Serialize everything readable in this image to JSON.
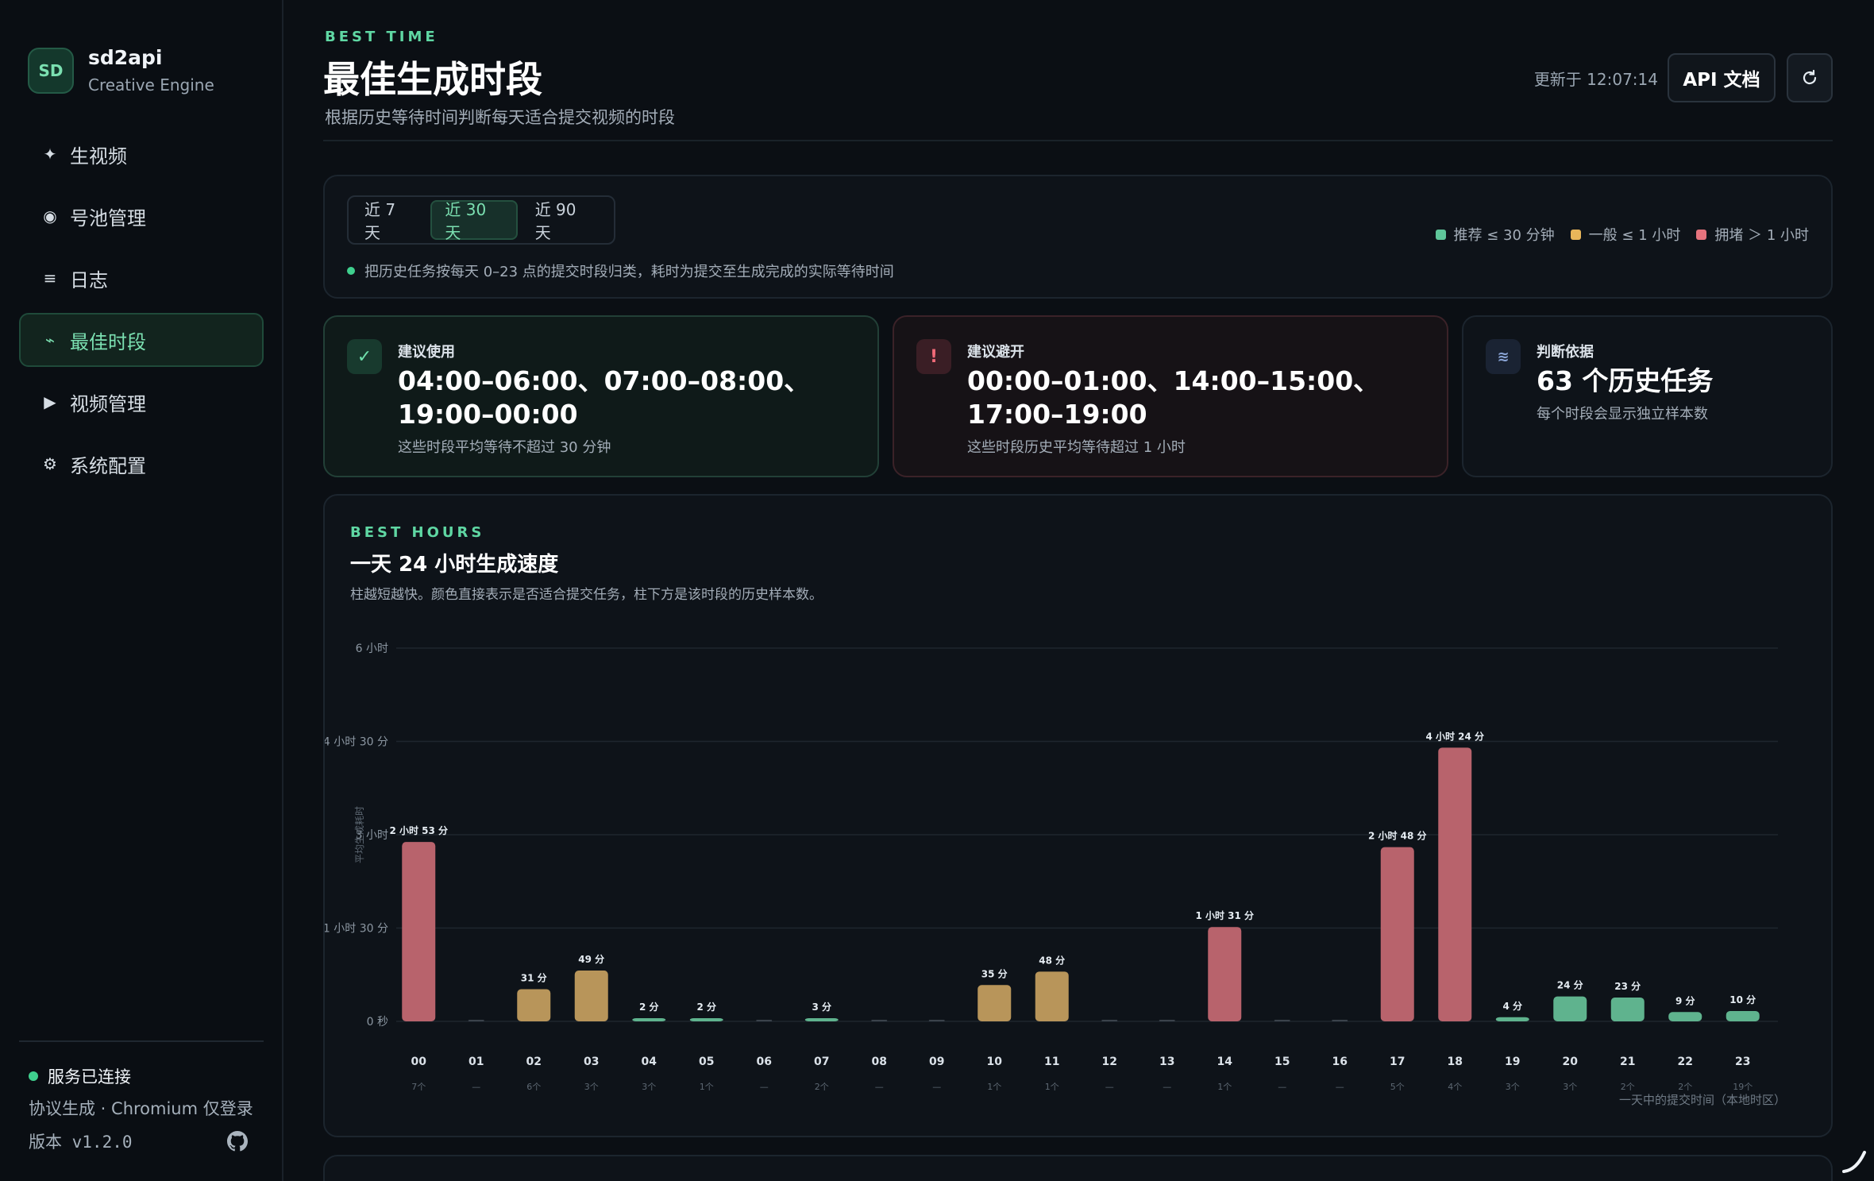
{
  "sidebar": {
    "logo": "SD",
    "name": "sd2api",
    "subtitle": "Creative Engine",
    "items": [
      {
        "label": "生视频",
        "icon": "sparkle-icon",
        "glyph": "✦"
      },
      {
        "label": "号池管理",
        "icon": "radio-icon",
        "glyph": "◉"
      },
      {
        "label": "日志",
        "icon": "list-icon",
        "glyph": "≡"
      },
      {
        "label": "最佳时段",
        "icon": "pulse-icon",
        "glyph": "⌁",
        "active": true
      },
      {
        "label": "视频管理",
        "icon": "play-icon",
        "glyph": "▶"
      },
      {
        "label": "系统配置",
        "icon": "gear-icon",
        "glyph": "⚙"
      }
    ],
    "status": "服务已连接",
    "status_sub": "协议生成 · Chromium 仅登录",
    "version": "版本 v1.2.0"
  },
  "header": {
    "eyebrow": "BEST TIME",
    "title": "最佳生成时段",
    "subtitle": "根据历史等待时间判断每天适合提交视频的时段",
    "updated": "更新于 12:07:14",
    "api_button": "API 文档"
  },
  "filters": {
    "tabs": [
      "近 7 天",
      "近 30 天",
      "近 90 天"
    ],
    "active_tab": 1,
    "note": "把历史任务按每天 0–23 点的提交时段归类，耗时为提交至生成完成的实际等待时间",
    "legend": [
      {
        "label": "推荐 ≤ 30 分钟",
        "color": "#5fc69a"
      },
      {
        "label": "一般 ≤ 1 小时",
        "color": "#e8b65a"
      },
      {
        "label": "拥堵 ＞ 1 小时",
        "color": "#e5737d"
      }
    ]
  },
  "stats": {
    "recommend": {
      "label": "建议使用",
      "value": "04:00–06:00、07:00–08:00、19:00–00:00",
      "foot": "这些时段平均等待不超过 30 分钟"
    },
    "avoid": {
      "label": "建议避开",
      "value": "00:00–01:00、14:00–15:00、17:00–19:00",
      "foot": "这些时段历史平均等待超过 1 小时"
    },
    "basis": {
      "label": "判断依据",
      "value": "63 个历史任务",
      "foot": "每个时段会显示独立样本数"
    }
  },
  "chart": {
    "eyebrow": "BEST HOURS",
    "title": "一天 24 小时生成速度",
    "subtitle": "柱越短越快。颜色直接表示是否适合提交任务，柱下方是该时段的历史样本数。"
  },
  "chart_data": {
    "type": "bar",
    "categories": [
      "00",
      "01",
      "02",
      "03",
      "04",
      "05",
      "06",
      "07",
      "08",
      "09",
      "10",
      "11",
      "12",
      "13",
      "14",
      "15",
      "16",
      "17",
      "18",
      "19",
      "20",
      "21",
      "22",
      "23"
    ],
    "values_minutes": [
      173,
      0,
      31,
      49,
      2,
      2,
      0,
      3,
      0,
      0,
      35,
      48,
      0,
      0,
      91,
      0,
      0,
      168,
      264,
      4,
      24,
      23,
      9,
      10
    ],
    "value_labels": [
      "2 小时 53 分",
      "",
      "31 分",
      "49 分",
      "2 分",
      "2 分",
      "",
      "3 分",
      "",
      "",
      "35 分",
      "48 分",
      "",
      "",
      "1 小时 31 分",
      "",
      "",
      "2 小时 48 分",
      "4 小时 24 分",
      "4 分",
      "24 分",
      "23 分",
      "9 分",
      "10 分"
    ],
    "samples": [
      "7个",
      "—",
      "6个",
      "3个",
      "3个",
      "1个",
      "—",
      "2个",
      "—",
      "—",
      "1个",
      "1个",
      "—",
      "—",
      "1个",
      "—",
      "—",
      "5个",
      "4个",
      "3个",
      "3个",
      "2个",
      "2个",
      "19个"
    ],
    "status": [
      "bad",
      "none",
      "mid",
      "mid",
      "good",
      "good",
      "none",
      "good",
      "none",
      "none",
      "mid",
      "mid",
      "none",
      "none",
      "bad",
      "none",
      "none",
      "bad",
      "bad",
      "good",
      "good",
      "good",
      "good",
      "good"
    ],
    "yticks": [
      {
        "value": 0,
        "label": "0 秒"
      },
      {
        "value": 90,
        "label": "1 小时 30 分"
      },
      {
        "value": 180,
        "label": "3 小时"
      },
      {
        "value": 270,
        "label": "4 小时 30 分"
      },
      {
        "value": 360,
        "label": "6 小时"
      }
    ],
    "ylim": [
      0,
      360
    ],
    "ylabel": "平均生成耗时",
    "xlabel": "一天中的提交时间（本地时区）",
    "colors": {
      "good": "#5fb38e",
      "mid": "#b8955a",
      "bad": "#b8636c",
      "none": "#3a424b"
    },
    "grid": true
  }
}
